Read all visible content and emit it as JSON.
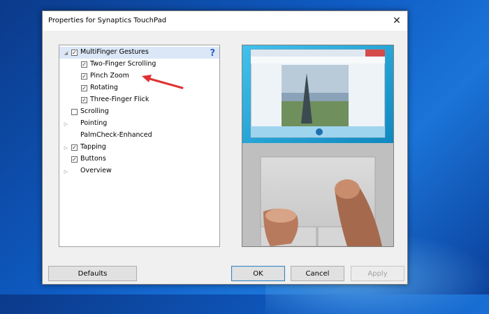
{
  "dialog": {
    "title": "Properties for Synaptics TouchPad",
    "close_glyph": "✕"
  },
  "tree": {
    "help_glyph": "?",
    "items": [
      {
        "label": "MultiFinger Gestures",
        "checked": true,
        "expander": "◢",
        "selected": true
      },
      {
        "label": "Two-Finger Scrolling",
        "checked": true
      },
      {
        "label": "Pinch Zoom",
        "checked": true
      },
      {
        "label": "Rotating",
        "checked": true
      },
      {
        "label": "Three-Finger Flick",
        "checked": true
      },
      {
        "label": "Scrolling",
        "checked": false
      },
      {
        "label": "Pointing",
        "expander": "▷"
      },
      {
        "label": "PalmCheck-Enhanced"
      },
      {
        "label": "Tapping",
        "checked": true,
        "expander": "▷"
      },
      {
        "label": "Buttons",
        "checked": true
      },
      {
        "label": "Overview",
        "expander": "▷"
      }
    ]
  },
  "buttons": {
    "defaults": "Defaults",
    "ok": "OK",
    "cancel": "Cancel",
    "apply": "Apply"
  },
  "colors": {
    "annotation_arrow": "#e03030",
    "help_icon": "#2a64c8",
    "selected_row": "#dbe7f7"
  }
}
